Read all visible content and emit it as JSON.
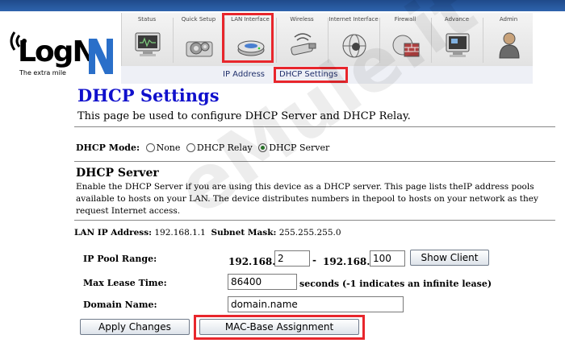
{
  "brand": {
    "logo_text": "LogN",
    "tagline": "The extra mile"
  },
  "nav": {
    "tabs": [
      {
        "label": "Status",
        "icon": "monitor-icon"
      },
      {
        "label": "Quick Setup",
        "icon": "gears-icon"
      },
      {
        "label": "LAN Interface",
        "icon": "router-icon",
        "active": true
      },
      {
        "label": "Wireless",
        "icon": "wireless-adapter-icon"
      },
      {
        "label": "Internet Interface",
        "icon": "globe-icon"
      },
      {
        "label": "Firewall",
        "icon": "firewall-icon"
      },
      {
        "label": "Advance",
        "icon": "advanced-icon"
      },
      {
        "label": "Admin",
        "icon": "admin-user-icon"
      }
    ],
    "subtabs": [
      {
        "label": "IP Address"
      },
      {
        "label": "DHCP Settings",
        "active": true
      }
    ]
  },
  "page": {
    "title": "DHCP Settings",
    "description": "This page be used to configure DHCP Server and DHCP Relay."
  },
  "mode": {
    "label": "DHCP Mode:",
    "options": [
      {
        "label": "None",
        "selected": false
      },
      {
        "label": "DHCP Relay",
        "selected": false
      },
      {
        "label": "DHCP Server",
        "selected": true
      }
    ]
  },
  "server": {
    "title": "DHCP Server",
    "description": "Enable the DHCP Server if you are using this device as a DHCP server. This page lists theIP address pools available to hosts on your LAN. The device distributes numbers in thepool to hosts on your network as they request Internet access.",
    "lan_ip_label": "LAN IP Address:",
    "lan_ip_value": "192.168.1.1",
    "subnet_label": "Subnet Mask:",
    "subnet_value": "255.255.255.0"
  },
  "form": {
    "pool_label": "IP Pool Range:",
    "pool_prefix_start": "192.168.1.",
    "pool_start": "2",
    "pool_dash": "-",
    "pool_prefix_end": "192.168.1.",
    "pool_end": "100",
    "show_client_label": "Show Client",
    "lease_label": "Max Lease Time:",
    "lease_value": "86400",
    "lease_suffix": "seconds (-1 indicates an infinite lease)",
    "domain_label": "Domain Name:",
    "domain_value": "domain.name",
    "apply_label": "Apply Changes",
    "mac_label": "MAC-Base Assignment"
  },
  "watermark": "eMule.it",
  "colors": {
    "title_blue": "#1010cc",
    "highlight_red": "#e8262c",
    "header_blue": "#1f4a8a"
  }
}
